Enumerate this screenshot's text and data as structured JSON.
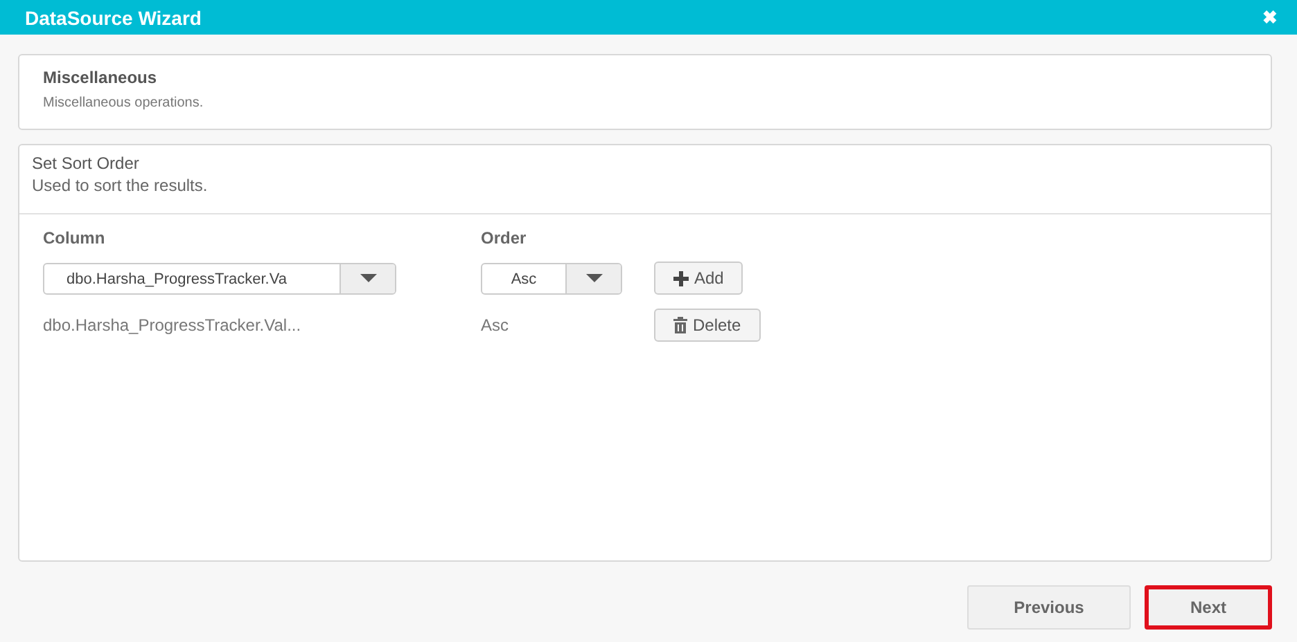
{
  "window": {
    "title": "DataSource Wizard",
    "close": "✖"
  },
  "miscellaneous": {
    "title": "Miscellaneous",
    "description": "Miscellaneous operations."
  },
  "sort": {
    "title": "Set Sort Order",
    "description": "Used to sort the results.",
    "columns": [
      "Column",
      "Order"
    ],
    "editor": {
      "column_value": "dbo.Harsha_ProgressTracker.Va",
      "order_value": "Asc",
      "add_label": "Add"
    },
    "rows": [
      {
        "column": "dbo.Harsha_ProgressTracker.Val...",
        "order": "Asc",
        "delete_label": "Delete"
      }
    ]
  },
  "buttons": [
    {
      "label": "Previous",
      "highlighted": false
    },
    {
      "label": "Next",
      "highlighted": true
    }
  ]
}
